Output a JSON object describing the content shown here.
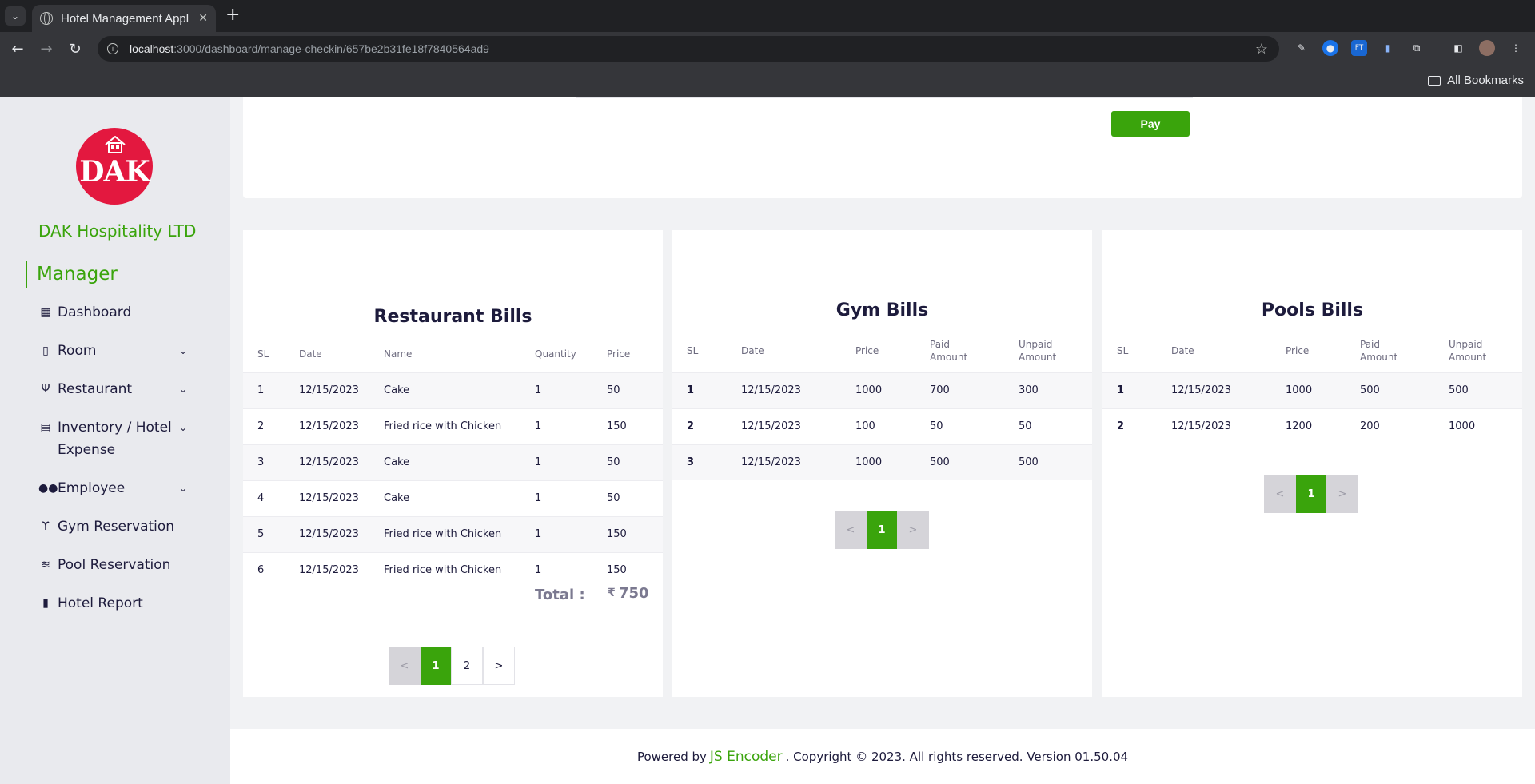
{
  "browser": {
    "tab_title": "Hotel Management Appl",
    "url_host": "localhost",
    "url_path": ":3000/dashboard/manage-checkin/657be2b31fe18f7840564ad9",
    "bookmarks_label": "All Bookmarks"
  },
  "sidebar": {
    "logo_text": "DAK",
    "company": "DAK Hospitality LTD",
    "role": "Manager",
    "items": [
      {
        "label": "Dashboard",
        "icon": "grid-icon",
        "expandable": false
      },
      {
        "label": "Room",
        "icon": "building-icon",
        "expandable": true
      },
      {
        "label": "Restaurant",
        "icon": "fork-knife-icon",
        "expandable": true
      },
      {
        "label": "Inventory / Hotel Expense",
        "icon": "box-icon",
        "expandable": true
      },
      {
        "label": "Employee",
        "icon": "users-icon",
        "expandable": true
      },
      {
        "label": "Gym Reservation",
        "icon": "gym-icon",
        "expandable": false
      },
      {
        "label": "Pool Reservation",
        "icon": "swim-icon",
        "expandable": false
      },
      {
        "label": "Hotel Report",
        "icon": "bar-chart-icon",
        "expandable": false
      }
    ]
  },
  "top_card": {
    "pay_label": "Pay"
  },
  "restaurant": {
    "title": "Restaurant Bills",
    "columns": [
      "SL",
      "Date",
      "Name",
      "Quantity",
      "Price"
    ],
    "rows": [
      [
        "1",
        "12/15/2023",
        "Cake",
        "1",
        "50"
      ],
      [
        "2",
        "12/15/2023",
        "Fried rice with Chicken",
        "1",
        "150"
      ],
      [
        "3",
        "12/15/2023",
        "Cake",
        "1",
        "50"
      ],
      [
        "4",
        "12/15/2023",
        "Cake",
        "1",
        "50"
      ],
      [
        "5",
        "12/15/2023",
        "Fried rice with Chicken",
        "1",
        "150"
      ],
      [
        "6",
        "12/15/2023",
        "Fried rice with Chicken",
        "1",
        "150"
      ]
    ],
    "total_label": "Total :",
    "total_currency": "₹",
    "total_value": "750",
    "pager": [
      "<",
      "1",
      "2",
      ">"
    ]
  },
  "gym": {
    "title": "Gym Bills",
    "columns": [
      "SL",
      "Date",
      "Price",
      "Paid Amount",
      "Unpaid Amount"
    ],
    "rows": [
      [
        "1",
        "12/15/2023",
        "1000",
        "700",
        "300"
      ],
      [
        "2",
        "12/15/2023",
        "100",
        "50",
        "50"
      ],
      [
        "3",
        "12/15/2023",
        "1000",
        "500",
        "500"
      ]
    ],
    "pager": [
      "<",
      "1",
      ">"
    ]
  },
  "pool": {
    "title": "Pools Bills",
    "columns": [
      "SL",
      "Date",
      "Price",
      "Paid Amount",
      "Unpaid Amount"
    ],
    "rows": [
      [
        "1",
        "12/15/2023",
        "1000",
        "500",
        "500"
      ],
      [
        "2",
        "12/15/2023",
        "1200",
        "200",
        "1000"
      ]
    ],
    "pager": [
      "<",
      "1",
      ">"
    ]
  },
  "footer": {
    "prefix": "Powered by",
    "brand": "JS Encoder",
    "suffix": ". Copyright © 2023. All rights reserved. Version 01.50.04"
  },
  "colors": {
    "accent": "#3aa40c",
    "logo": "#e3183f",
    "sidebar": "#e9eaee"
  }
}
